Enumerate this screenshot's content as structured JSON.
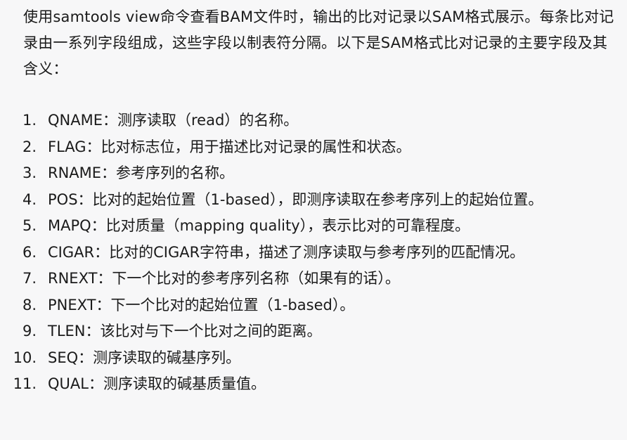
{
  "intro": "使用samtools view命令查看BAM文件时，输出的比对记录以SAM格式展示。每条比对记录由一系列字段组成，这些字段以制表符分隔。以下是SAM格式比对记录的主要字段及其含义：",
  "fields": [
    {
      "num": "1.",
      "text": "QNAME：测序读取（read）的名称。"
    },
    {
      "num": "2.",
      "text": "FLAG：比对标志位，用于描述比对记录的属性和状态。"
    },
    {
      "num": "3.",
      "text": "RNAME：参考序列的名称。"
    },
    {
      "num": "4.",
      "text": "POS：比对的起始位置（1-based），即测序读取在参考序列上的起始位置。"
    },
    {
      "num": "5.",
      "text": "MAPQ：比对质量（mapping quality），表示比对的可靠程度。"
    },
    {
      "num": "6.",
      "text": "CIGAR：比对的CIGAR字符串，描述了测序读取与参考序列的匹配情况。"
    },
    {
      "num": "7.",
      "text": "RNEXT：下一个比对的参考序列名称（如果有的话）。"
    },
    {
      "num": "8.",
      "text": "PNEXT：下一个比对的起始位置（1-based）。"
    },
    {
      "num": "9.",
      "text": "TLEN：该比对与下一个比对之间的距离。"
    },
    {
      "num": "10.",
      "text": "SEQ：测序读取的碱基序列。"
    },
    {
      "num": "11.",
      "text": "QUAL：测序读取的碱基质量值。"
    }
  ]
}
